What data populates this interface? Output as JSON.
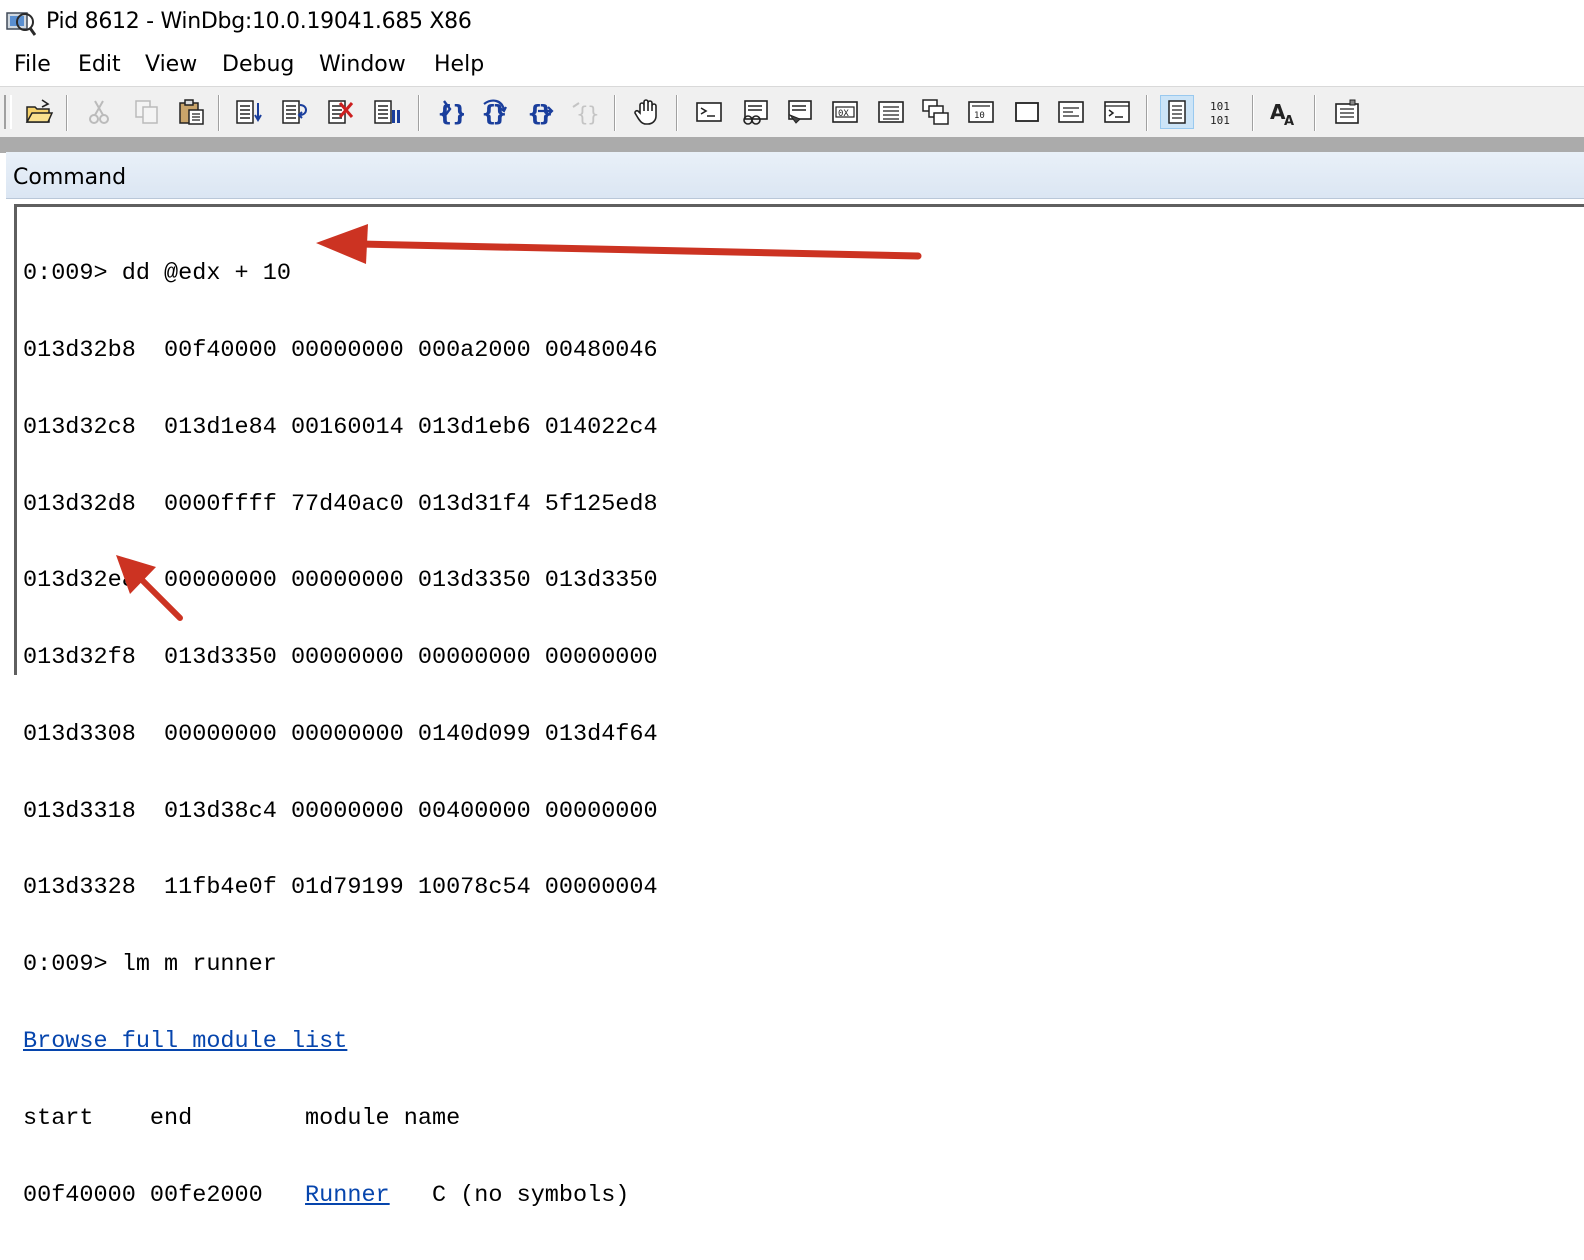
{
  "window": {
    "title": "Pid 8612 - WinDbg:10.0.19041.685 X86"
  },
  "menu": [
    "File",
    "Edit",
    "View",
    "Debug",
    "Window",
    "Help"
  ],
  "toolbar": {
    "buttons": [
      "open-icon",
      "cut-icon",
      "copy-icon",
      "paste-icon",
      "step-into-source-icon",
      "step-over-source-icon",
      "breakpoint-clear-icon",
      "run-to-cursor-icon",
      "step-into-icon",
      "step-over-icon",
      "step-out-icon",
      "run-to-cursor-disabled-icon",
      "break-hand-icon",
      "command-window-icon",
      "watch-window-icon",
      "locals-window-icon",
      "registers-window-icon",
      "memory-window-icon",
      "call-stack-window-icon",
      "disassembly-window-icon",
      "scratch-pad-icon",
      "processes-threads-icon",
      "command-browser-icon",
      "source-mode-icon",
      "hex-display-icon",
      "font-icon",
      "options-icon"
    ],
    "hex_glyph_top": "101",
    "hex_glyph_bottom": "101",
    "font_glyph": "A"
  },
  "command_panel": {
    "title": "Command"
  },
  "console": {
    "prompt1": "0:009> dd @edx + 10",
    "rows": [
      "013d32b8  00f40000 00000000 000a2000 00480046",
      "013d32c8  013d1e84 00160014 013d1eb6 014022c4",
      "013d32d8  0000ffff 77d40ac0 013d31f4 5f125ed8",
      "013d32e8  00000000 00000000 013d3350 013d3350",
      "013d32f8  013d3350 00000000 00000000 00000000",
      "013d3308  00000000 00000000 0140d099 013d4f64",
      "013d3318  013d38c4 00000000 00400000 00000000",
      "013d3328  11fb4e0f 01d79199 10078c54 00000004"
    ],
    "prompt2": "0:009> lm m runner",
    "browse_link": "Browse full module list",
    "module_header": "start    end        module name",
    "module_row_prefix": "00f40000 00fe2000   ",
    "module_link": "Runner",
    "module_row_suffix": "   C (no symbols)"
  },
  "colors": {
    "arrow": "#cc3322",
    "link": "#0645ad",
    "panel_header": "#dbe6f3"
  }
}
